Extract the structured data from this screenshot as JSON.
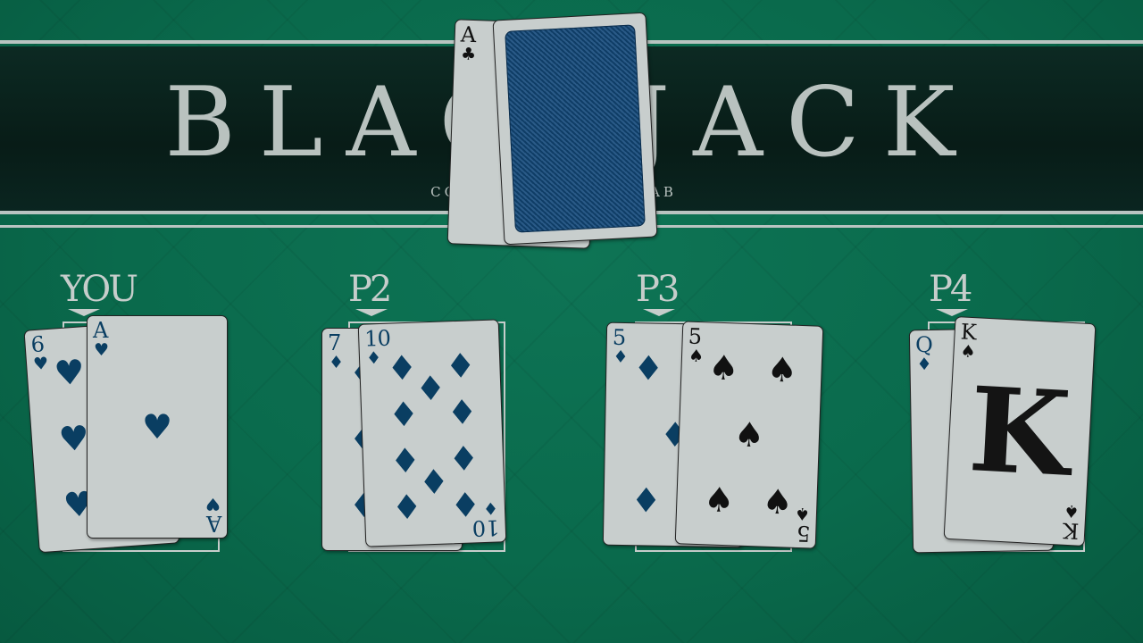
{
  "title": "BLACKJACK",
  "subtitle": "COMPUTACIÓN I - UCAB",
  "deck": {
    "top_card": {
      "rank": "A",
      "suit": "♣",
      "color": "black"
    }
  },
  "players": [
    {
      "label": "YOU",
      "cards": [
        {
          "rank": "6",
          "suit": "♥",
          "color": "blue"
        },
        {
          "rank": "A",
          "suit": "♥",
          "color": "blue"
        }
      ]
    },
    {
      "label": "P2",
      "cards": [
        {
          "rank": "7",
          "suit": "♦",
          "color": "blue"
        },
        {
          "rank": "10",
          "suit": "♦",
          "color": "blue"
        }
      ]
    },
    {
      "label": "P3",
      "cards": [
        {
          "rank": "5",
          "suit": "♦",
          "color": "blue"
        },
        {
          "rank": "5",
          "suit": "♠",
          "color": "black"
        }
      ]
    },
    {
      "label": "P4",
      "cards": [
        {
          "rank": "Q",
          "suit": "♦",
          "color": "blue"
        },
        {
          "rank": "K",
          "suit": "♠",
          "color": "black"
        }
      ]
    }
  ]
}
